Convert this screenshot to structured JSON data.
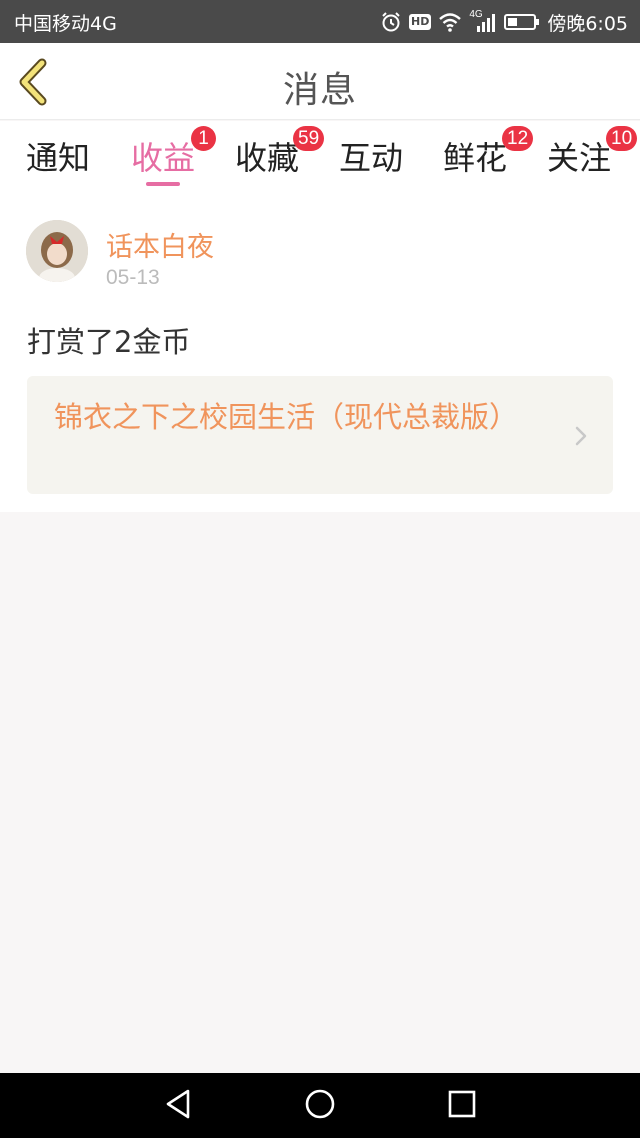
{
  "status_bar": {
    "carrier": "中国移动4G",
    "hd_label": "HD",
    "network_label": "4G",
    "time": "傍晚6:05",
    "icons": [
      "alarm-icon",
      "hd-icon",
      "wifi-icon",
      "signal-icon",
      "battery-icon"
    ]
  },
  "header": {
    "title": "消息",
    "back_icon": "chevron-left-icon"
  },
  "tabs": [
    {
      "label": "通知",
      "badge": "",
      "active": false
    },
    {
      "label": "收益",
      "badge": "1",
      "active": true
    },
    {
      "label": "收藏",
      "badge": "59",
      "active": false
    },
    {
      "label": "互动",
      "badge": "",
      "active": false
    },
    {
      "label": "鲜花",
      "badge": "12",
      "active": false
    },
    {
      "label": "关注",
      "badge": "10",
      "active": false
    }
  ],
  "message": {
    "username": "话本白夜",
    "date": "05-13",
    "text": "打赏了2金币",
    "book_title": "锦衣之下之校园生活（现代总裁版）"
  },
  "colors": {
    "accent_pink": "#e66da3",
    "accent_orange": "#f0945c",
    "badge_red": "#ea3344",
    "status_bar": "#4a4a4a",
    "card_bg": "#f5f4ef"
  },
  "nav_bar": {
    "icons": [
      "back-triangle-icon",
      "home-circle-icon",
      "recents-square-icon"
    ]
  }
}
